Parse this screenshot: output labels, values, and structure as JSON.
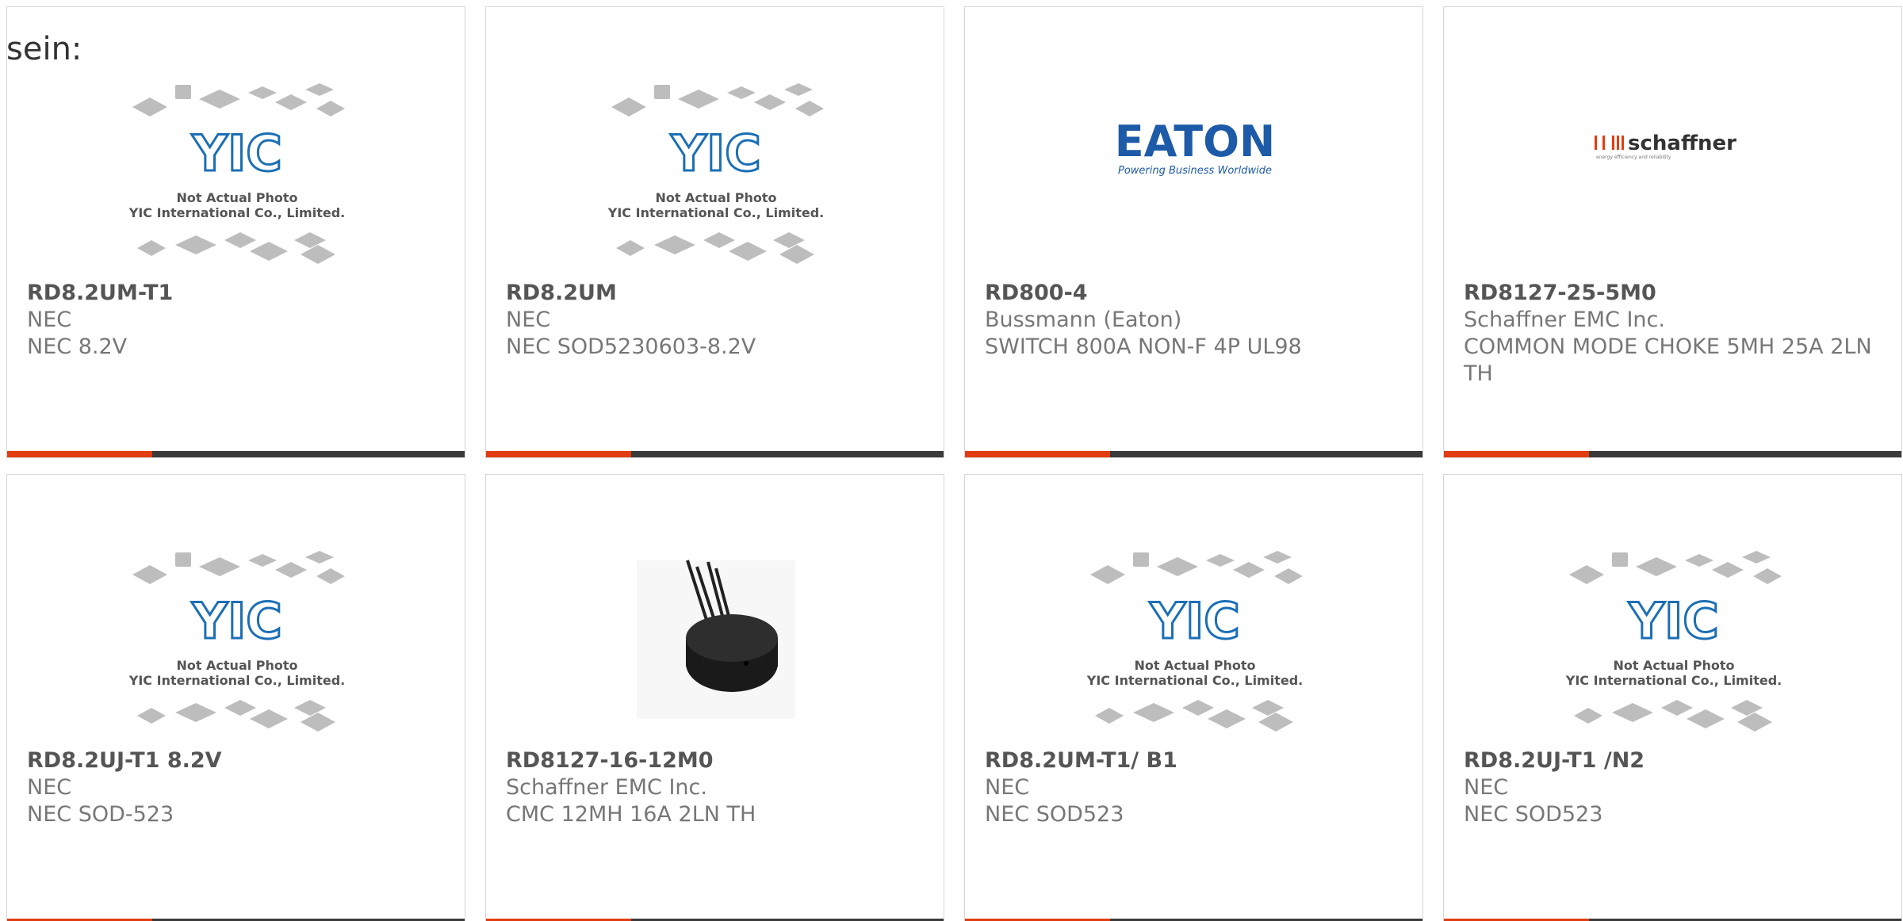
{
  "intro": {
    "text": "sein:"
  },
  "products": [
    {
      "part": "RD8.2UM-T1",
      "manufacturer": "NEC",
      "description": "NEC 8.2V",
      "image": "yic-placeholder"
    },
    {
      "part": "RD8.2UM",
      "manufacturer": "NEC",
      "description": "NEC SOD5230603-8.2V",
      "image": "yic-placeholder"
    },
    {
      "part": "RD800-4",
      "manufacturer": "Bussmann (Eaton)",
      "description": "SWITCH 800A NON-F 4P UL98",
      "image": "eaton-logo"
    },
    {
      "part": "RD8127-25-5M0",
      "manufacturer": "Schaffner EMC Inc.",
      "description": "COMMON MODE CHOKE 5MH 25A 2LN TH",
      "image": "schaffner-logo"
    },
    {
      "part": "RD8.2UJ-T1 8.2V",
      "manufacturer": "NEC",
      "description": "NEC SOD-523",
      "image": "yic-placeholder"
    },
    {
      "part": "RD8127-16-12M0",
      "manufacturer": "Schaffner EMC Inc.",
      "description": "CMC 12MH 16A 2LN TH",
      "image": "choke-photo"
    },
    {
      "part": "RD8.2UM-T1/ B1",
      "manufacturer": "NEC",
      "description": "NEC SOD523",
      "image": "yic-placeholder"
    },
    {
      "part": "RD8.2UJ-T1 /N2",
      "manufacturer": "NEC",
      "description": "NEC SOD523",
      "image": "yic-placeholder"
    }
  ],
  "placeholder": {
    "brand": "YIC",
    "line1": "Not Actual Photo",
    "line2": "YIC International Co., Limited."
  },
  "eaton": {
    "brand": "EATON",
    "tagline": "Powering Business Worldwide"
  },
  "schaffner": {
    "brand": "schaffner",
    "tagline": "energy efficiency and reliability"
  },
  "colors": {
    "accent": "#e23d12",
    "bar": "#3b3b3b",
    "border": "#d6d6d6",
    "eaton_blue": "#1d5aa8",
    "yic_blue": "#1b6fb5"
  }
}
